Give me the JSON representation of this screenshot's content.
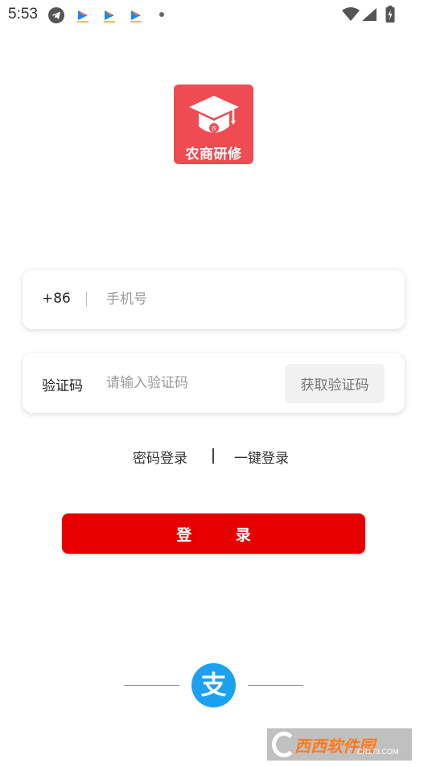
{
  "status_bar": {
    "time": "5:53",
    "icons": [
      "telegram-icon",
      "app-notification-icon",
      "app-notification-icon",
      "app-notification-icon",
      "more-dot-icon",
      "wifi-icon",
      "signal-icon",
      "battery-icon"
    ]
  },
  "logo": {
    "text": "农商研修",
    "icon": "graduation-cap-icon",
    "color": "#ee4b52"
  },
  "phone_field": {
    "country_code": "+86",
    "placeholder": "手机号",
    "value": ""
  },
  "code_field": {
    "label": "验证码",
    "placeholder": "请输入验证码",
    "value": "",
    "get_code_label": "获取验证码"
  },
  "login_options": {
    "password_login": "密码登录",
    "one_click_login": "一键登录"
  },
  "login_button": {
    "label": "登 录",
    "color": "#e60000"
  },
  "third_party": {
    "icon": "alipay-icon",
    "color": "#1ba1f0"
  },
  "watermark": {
    "text": "西西软件园",
    "sub": "CR173.COM"
  }
}
